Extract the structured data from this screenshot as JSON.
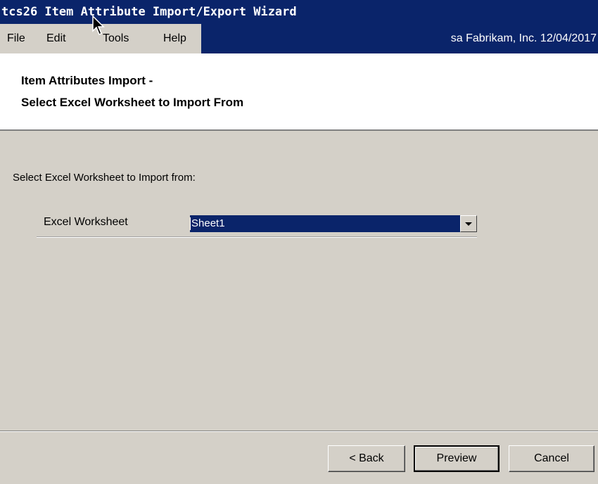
{
  "window": {
    "title": "tcs26 Item Attribute Import/Export Wizard"
  },
  "menubar": {
    "items": [
      {
        "label": "File"
      },
      {
        "label": "Edit"
      },
      {
        "label": "Tools"
      },
      {
        "label": "Help"
      }
    ],
    "status": "sa  Fabrikam, Inc.  12/04/2017"
  },
  "header": {
    "line1": "Item Attributes Import -",
    "line2": "Select Excel Worksheet to Import From"
  },
  "content": {
    "instruction": "Select Excel Worksheet to Import from:",
    "field_label": "Excel Worksheet",
    "worksheet_value": "Sheet1"
  },
  "buttons": {
    "back": "< Back",
    "preview": "Preview",
    "cancel": "Cancel"
  },
  "colors": {
    "titlebar": "#0a246a",
    "face": "#d4d0c8",
    "selection": "#0a246a"
  },
  "icons": {
    "cursor": "mouse-pointer-icon",
    "dropdown": "dropdown-arrow-icon"
  }
}
